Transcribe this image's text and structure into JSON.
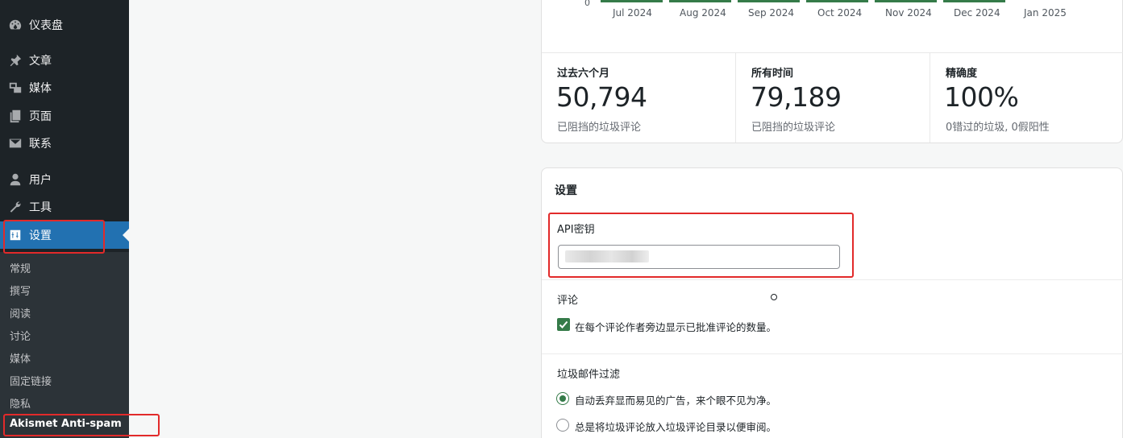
{
  "sidebar": {
    "items": [
      {
        "label": "仪表盘",
        "icon": "dashboard-icon"
      },
      {
        "label": "文章",
        "icon": "pin-icon"
      },
      {
        "label": "媒体",
        "icon": "media-icon"
      },
      {
        "label": "页面",
        "icon": "pages-icon"
      },
      {
        "label": "联系",
        "icon": "mail-icon"
      },
      {
        "label": "用户",
        "icon": "user-icon"
      },
      {
        "label": "工具",
        "icon": "wrench-icon"
      },
      {
        "label": "设置",
        "icon": "settings-icon"
      }
    ],
    "submenu": [
      "常规",
      "撰写",
      "阅读",
      "讨论",
      "媒体",
      "固定链接",
      "隐私",
      "Akismet Anti-spam"
    ]
  },
  "chart": {
    "y_zero": "0",
    "months": [
      "Jul 2024",
      "Aug 2024",
      "Sep 2024",
      "Oct 2024",
      "Nov 2024",
      "Dec 2024",
      "Jan 2025"
    ],
    "bar_color": "#357b49"
  },
  "stats": [
    {
      "label": "过去六个月",
      "value": "50,794",
      "desc": "已阻挡的垃圾评论"
    },
    {
      "label": "所有时间",
      "value": "79,189",
      "desc": "已阻挡的垃圾评论"
    },
    {
      "label": "精确度",
      "value": "100%",
      "desc": "0错过的垃圾, 0假阳性"
    }
  ],
  "settings": {
    "title": "设置",
    "api_key_label": "API密钥",
    "api_key_value": "",
    "comments_label": "评论",
    "comments_option": "在每个评论作者旁边显示已批准评论的数量。",
    "spam_filter_label": "垃圾邮件过滤",
    "spam_options": [
      "自动丢弃显而易见的广告，来个眼不见为净。",
      "总是将垃圾评论放入垃圾评论目录以便审阅。"
    ]
  },
  "colors": {
    "accent": "#2271b1",
    "highlight": "#e22a2a",
    "green": "#357b49"
  }
}
